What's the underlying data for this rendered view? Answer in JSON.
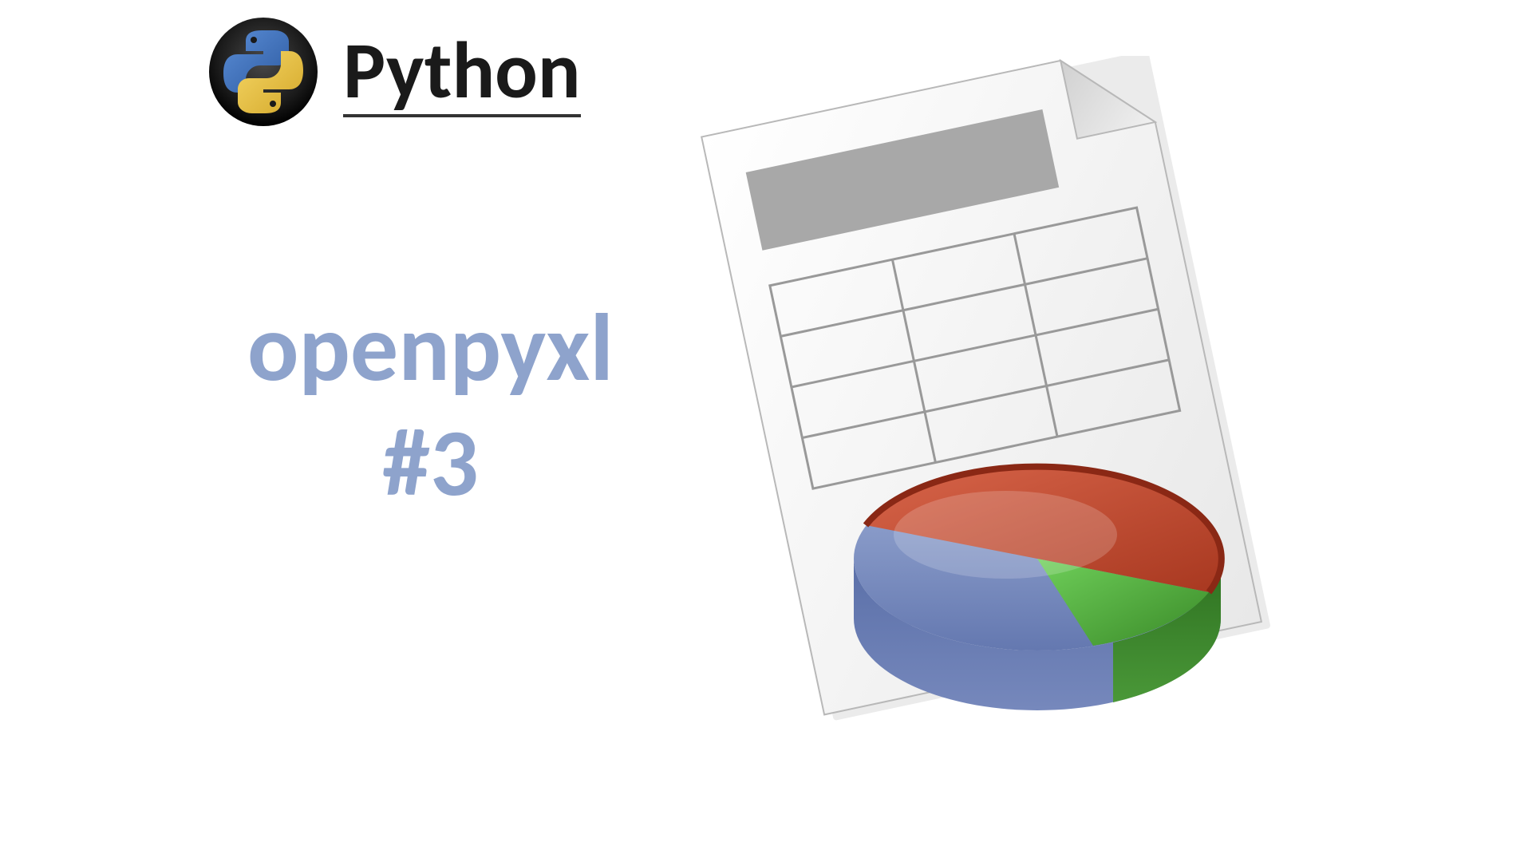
{
  "header": {
    "title": "Python"
  },
  "main": {
    "line1": "openpyxl",
    "line2": "#3"
  },
  "colors": {
    "text_accent": "#8ea3cc",
    "pie_blue": "#8094c2",
    "pie_red": "#c24b2d",
    "pie_green": "#4ea83c"
  }
}
